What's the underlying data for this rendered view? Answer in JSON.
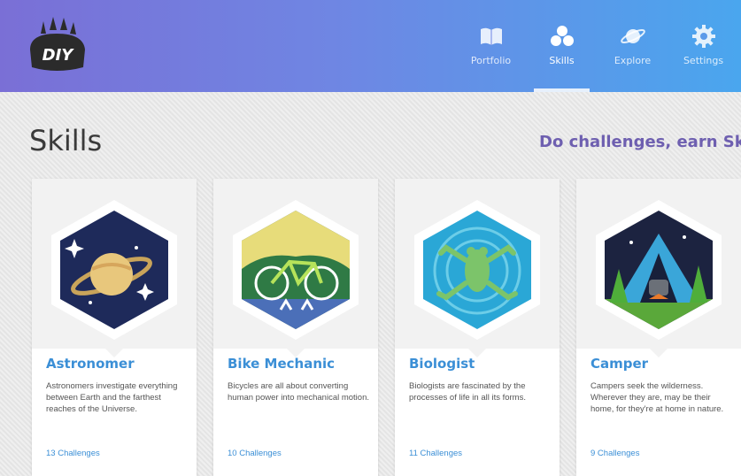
{
  "nav": {
    "items": [
      {
        "label": "Portfolio",
        "icon": "book-icon",
        "active": false
      },
      {
        "label": "Skills",
        "icon": "skills-icon",
        "active": true
      },
      {
        "label": "Explore",
        "icon": "planet-icon",
        "active": false
      },
      {
        "label": "Settings",
        "icon": "gear-icon",
        "active": false
      }
    ]
  },
  "brand": {
    "logo_text": "DIY"
  },
  "page": {
    "title": "Skills",
    "tagline": "Do challenges, earn Skills."
  },
  "cards": [
    {
      "title": "Astronomer",
      "description": "Astronomers investigate everything between Earth and the farthest reaches of the Universe.",
      "challenges": "13 Challenges",
      "badge": "astronomer-badge-icon"
    },
    {
      "title": "Bike Mechanic",
      "description": "Bicycles are all about converting human power into mechanical motion.",
      "challenges": "10 Challenges",
      "badge": "bike-badge-icon"
    },
    {
      "title": "Biologist",
      "description": "Biologists are fascinated by the processes of life in all its forms.",
      "challenges": "11 Challenges",
      "badge": "frog-badge-icon"
    },
    {
      "title": "Camper",
      "description": "Campers seek the wilderness. Wherever they are, may be their home, for they're at home in nature.",
      "challenges": "9 Challenges",
      "badge": "tent-badge-icon"
    }
  ],
  "colors": {
    "header_start": "#7a6fd6",
    "header_end": "#4aa6ee",
    "link": "#3b8fd6",
    "tagline": "#6e5fb0"
  }
}
